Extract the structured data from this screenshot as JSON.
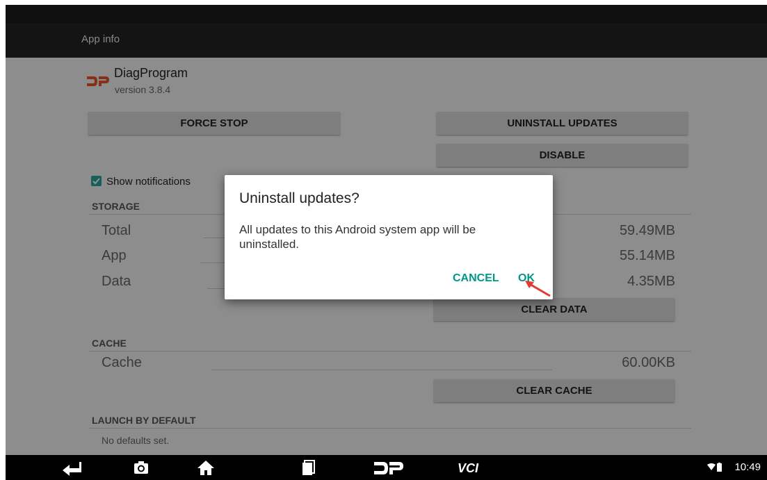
{
  "appbar": {
    "title": "App info"
  },
  "app": {
    "name": "DiagProgram",
    "version": "version 3.8.4",
    "logo_icon": "dp-logo-icon"
  },
  "buttons": {
    "force_stop": "FORCE STOP",
    "uninstall_updates": "UNINSTALL UPDATES",
    "disable": "DISABLE",
    "clear_data": "CLEAR DATA",
    "clear_cache": "CLEAR CACHE"
  },
  "notifications": {
    "label": "Show notifications",
    "checked": true
  },
  "storage": {
    "header": "STORAGE",
    "rows": [
      {
        "label": "Total",
        "value": "59.49MB"
      },
      {
        "label": "App",
        "value": "55.14MB"
      },
      {
        "label": "Data",
        "value": "4.35MB"
      }
    ]
  },
  "cache": {
    "header": "CACHE",
    "rows": [
      {
        "label": "Cache",
        "value": "60.00KB"
      }
    ]
  },
  "launch": {
    "header": "LAUNCH BY DEFAULT",
    "text": "No defaults set."
  },
  "dialog": {
    "title": "Uninstall updates?",
    "message": "All updates to this Android system app will be uninstalled.",
    "cancel_label": "CANCEL",
    "ok_label": "OK"
  },
  "navbar": {
    "icons": [
      "back-icon",
      "camera-icon",
      "home-icon",
      "recents-icon",
      "dp-icon",
      "vci-icon"
    ],
    "time": "10:49"
  },
  "colors": {
    "accent": "#009688",
    "checkbox": "#26a69a",
    "pointer": "#e53935"
  }
}
